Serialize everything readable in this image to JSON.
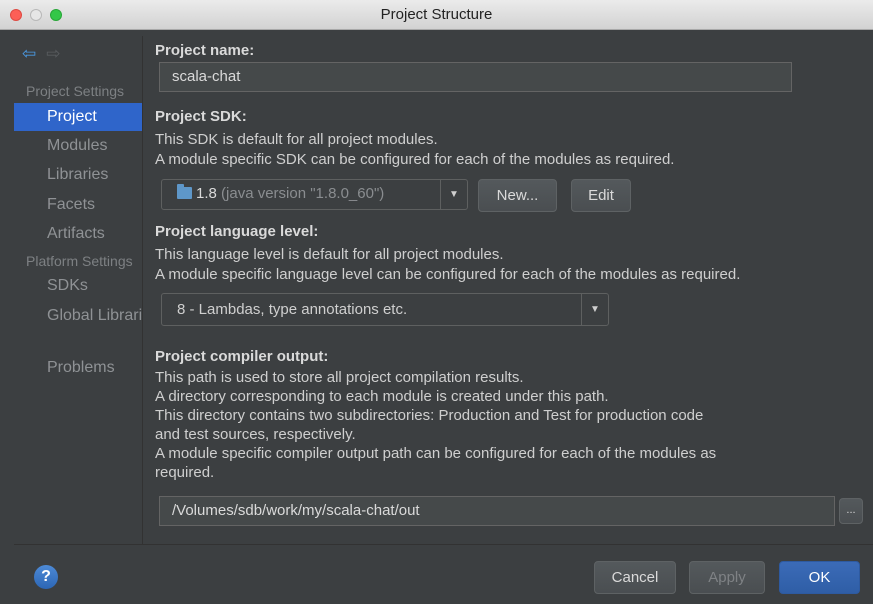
{
  "window": {
    "title": "Project Structure"
  },
  "sidebar": {
    "sections": [
      "Project Settings",
      "Platform Settings"
    ],
    "project_items": [
      "Project",
      "Modules",
      "Libraries",
      "Facets",
      "Artifacts"
    ],
    "platform_items": [
      "SDKs",
      "Global Libraries"
    ],
    "problems": "Problems"
  },
  "project_name": {
    "label": "Project name:",
    "value": "scala-chat"
  },
  "project_sdk": {
    "label": "Project SDK:",
    "desc1": "This SDK is default for all project modules.",
    "desc2": "A module specific SDK can be configured for each of the modules as required.",
    "sdk_version": "1.8",
    "sdk_detail": "(java version \"1.8.0_60\")",
    "new_label": "New...",
    "edit_label": "Edit"
  },
  "language_level": {
    "label": "Project language level:",
    "desc1": "This language level is default for all project modules.",
    "desc2": "A module specific language level can be configured for each of the modules as required.",
    "value": "8 - Lambdas, type annotations etc."
  },
  "compiler_output": {
    "label": "Project compiler output:",
    "lines": [
      "This path is used to store all project compilation results.",
      "A directory corresponding to each module is created under this path.",
      "This directory contains two subdirectories: Production and Test for production code",
      "and test sources, respectively.",
      "A module specific compiler output path can be configured for each of the modules as",
      "required."
    ],
    "path": "/Volumes/sdb/work/my/scala-chat/out",
    "browse_label": "..."
  },
  "footer": {
    "help": "?",
    "cancel": "Cancel",
    "apply": "Apply",
    "ok": "OK"
  },
  "icons": {
    "back": "back-arrow-icon",
    "forward": "forward-arrow-icon",
    "folder": "sdk-folder-icon",
    "dropdown": "chevron-down-icon"
  },
  "colors": {
    "selection": "#2f65ca",
    "background": "#3c3f41",
    "ok_button": "#2f5ea6"
  }
}
